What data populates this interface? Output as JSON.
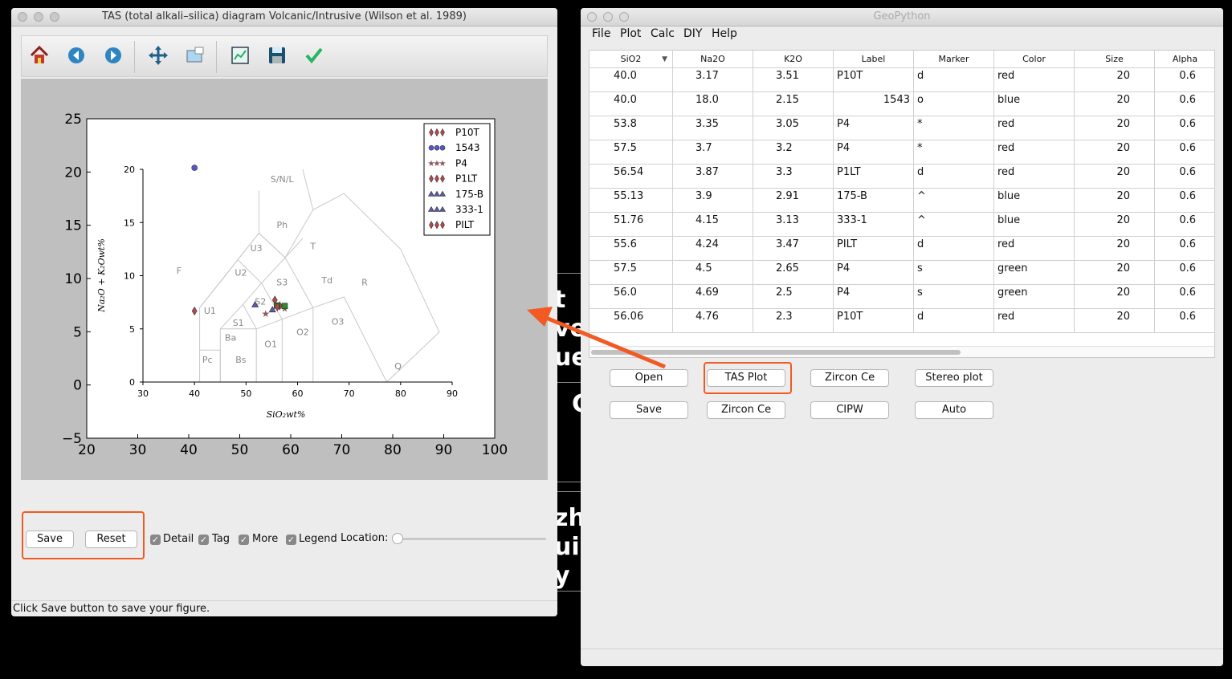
{
  "background": {
    "fragments": [
      "t",
      "ve",
      "ue",
      "C",
      "zh",
      "ui",
      "y"
    ]
  },
  "plot_window": {
    "title": "TAS (total alkali–silica) diagram Volcanic/Intrusive (Wilson et al. 1989)",
    "toolbar": [
      "home-icon",
      "back-icon",
      "forward-icon",
      "pan-icon",
      "zoom-icon",
      "subplots-icon",
      "save-icon",
      "check-icon"
    ],
    "buttons": {
      "save": "Save",
      "reset": "Reset"
    },
    "checkboxes": [
      {
        "label": "Detail",
        "checked": true
      },
      {
        "label": "Tag",
        "checked": true
      },
      {
        "label": "More",
        "checked": true
      },
      {
        "label": "Legend",
        "checked": true
      }
    ],
    "location_label": "Location:",
    "location_value": 0,
    "status": "Click Save button to save your figure."
  },
  "chart_data": {
    "type": "scatter",
    "outer_axes": {
      "xlim": [
        20,
        100
      ],
      "ylim": [
        -5,
        25
      ],
      "xticks": [
        "20",
        "30",
        "40",
        "50",
        "60",
        "70",
        "80",
        "90",
        "100"
      ],
      "yticks": [
        "−5",
        "0",
        "5",
        "10",
        "15",
        "20",
        "25"
      ]
    },
    "inner_axes": {
      "xlim": [
        30,
        90
      ],
      "ylim": [
        0,
        20
      ],
      "xticks": [
        "30",
        "40",
        "50",
        "60",
        "70",
        "80",
        "90"
      ],
      "yticks": [
        "0",
        "5",
        "10",
        "15",
        "20"
      ],
      "xlabel": "SiO₂wt%",
      "ylabel": "Na₂O + K₂Owt%"
    },
    "fields": [
      "S/N/L",
      "Ph",
      "U3",
      "T",
      "F",
      "U2",
      "S3",
      "Td",
      "R",
      "S2",
      "U1",
      "S1",
      "O2",
      "O3",
      "Ba",
      "O1",
      "Pc",
      "Bs",
      "Q"
    ],
    "legend": [
      {
        "name": "P10T",
        "marker": "diamond",
        "color": "#b84848"
      },
      {
        "name": "1543",
        "marker": "circle",
        "color": "#5656c8"
      },
      {
        "name": "P4",
        "marker": "star",
        "color": "#8a5a5a"
      },
      {
        "name": "P1LT",
        "marker": "diamond",
        "color": "#b84848"
      },
      {
        "name": "175-B",
        "marker": "triangle",
        "color": "#5a5aa8"
      },
      {
        "name": "333-1",
        "marker": "triangle",
        "color": "#5a5aa8"
      },
      {
        "name": "PILT",
        "marker": "diamond",
        "color": "#b84848"
      }
    ],
    "legend_location": "top-right",
    "points": [
      {
        "x": 40.0,
        "y": 6.68,
        "marker": "diamond",
        "color": "#b84848"
      },
      {
        "x": 40.0,
        "y": 20.15,
        "marker": "circle",
        "color": "#5656c8"
      },
      {
        "x": 53.8,
        "y": 6.4,
        "marker": "star",
        "color": "#8a5a5a"
      },
      {
        "x": 57.5,
        "y": 6.9,
        "marker": "star",
        "color": "#8a5a5a"
      },
      {
        "x": 56.54,
        "y": 7.17,
        "marker": "diamond",
        "color": "#b84848"
      },
      {
        "x": 55.13,
        "y": 6.81,
        "marker": "triangle",
        "color": "#5a5aa8"
      },
      {
        "x": 51.76,
        "y": 7.28,
        "marker": "triangle",
        "color": "#5a5aa8"
      },
      {
        "x": 55.6,
        "y": 7.71,
        "marker": "diamond",
        "color": "#b84848"
      },
      {
        "x": 57.5,
        "y": 7.15,
        "marker": "square",
        "color": "#2e8b2e"
      },
      {
        "x": 56.0,
        "y": 7.19,
        "marker": "square",
        "color": "#2e8b2e"
      },
      {
        "x": 56.06,
        "y": 7.06,
        "marker": "diamond",
        "color": "#b84848"
      }
    ]
  },
  "main_window": {
    "title": "GeoPython",
    "menu": [
      "File",
      "Plot",
      "Calc",
      "DIY",
      "Help"
    ],
    "table": {
      "columns": [
        "SiO2",
        "Na2O",
        "K2O",
        "Label",
        "Marker",
        "Color",
        "Size",
        "Alpha"
      ],
      "rows": [
        [
          "40.0",
          "3.17",
          "3.51",
          "P10T",
          "d",
          "red",
          "20",
          "0.6"
        ],
        [
          "40.0",
          "18.0",
          "2.15",
          "1543",
          "o",
          "blue",
          "20",
          "0.6"
        ],
        [
          "53.8",
          "3.35",
          "3.05",
          "P4",
          "*",
          "red",
          "20",
          "0.6"
        ],
        [
          "57.5",
          "3.7",
          "3.2",
          "P4",
          "*",
          "red",
          "20",
          "0.6"
        ],
        [
          "56.54",
          "3.87",
          "3.3",
          "P1LT",
          "d",
          "red",
          "20",
          "0.6"
        ],
        [
          "55.13",
          "3.9",
          "2.91",
          "175-B",
          "^",
          "blue",
          "20",
          "0.6"
        ],
        [
          "51.76",
          "4.15",
          "3.13",
          "333-1",
          "^",
          "blue",
          "20",
          "0.6"
        ],
        [
          "55.6",
          "4.24",
          "3.47",
          "PILT",
          "d",
          "red",
          "20",
          "0.6"
        ],
        [
          "57.5",
          "4.5",
          "2.65",
          "P4",
          "s",
          "green",
          "20",
          "0.6"
        ],
        [
          "56.0",
          "4.69",
          "2.5",
          "P4",
          "s",
          "green",
          "20",
          "0.6"
        ],
        [
          "56.06",
          "4.76",
          "2.3",
          "P10T",
          "d",
          "red",
          "20",
          "0.6"
        ]
      ]
    },
    "buttons_row1": [
      "Open",
      "TAS Plot",
      "Zircon Ce",
      "Stereo plot"
    ],
    "buttons_row2": [
      "Save",
      "Zircon Ce",
      "CIPW",
      "Auto"
    ]
  },
  "colors": {
    "annotation": "#f15a22",
    "canvas_bg": "#bfbfbf",
    "window_bg": "#ececec"
  }
}
